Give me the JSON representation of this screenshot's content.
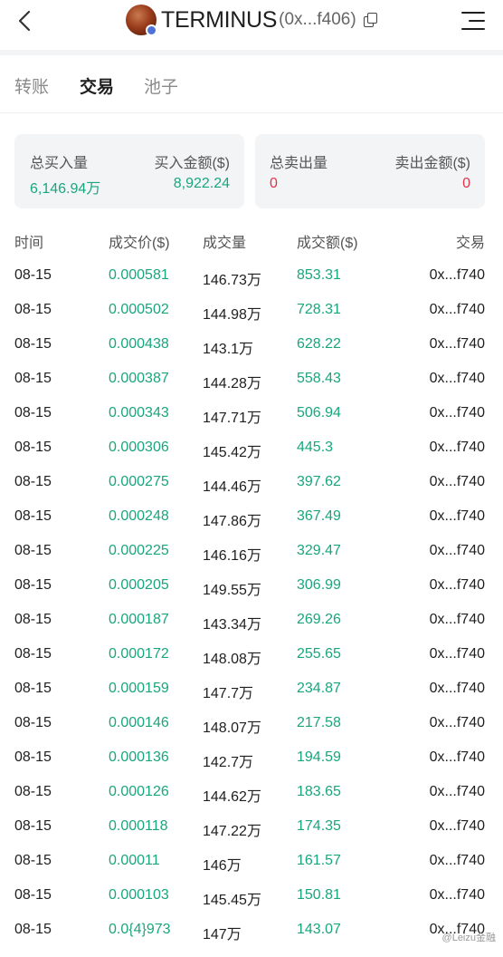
{
  "header": {
    "token_name": "TERMINUS",
    "token_address": "(0x...f406)"
  },
  "icons": {
    "back": "chevron-left-icon",
    "copy": "copy-icon",
    "menu": "menu-icon",
    "avatar": "token-avatar"
  },
  "tabs": [
    {
      "label": "转账"
    },
    {
      "label": "交易"
    },
    {
      "label": "池子"
    }
  ],
  "active_tab": "交易",
  "summary": {
    "buy": {
      "total_label": "总买入量",
      "total_value": "6,146.94万",
      "amount_label": "买入金额($)",
      "amount_value": "8,922.24"
    },
    "sell": {
      "total_label": "总卖出量",
      "total_value": "0",
      "amount_label": "卖出金额($)",
      "amount_value": "0"
    }
  },
  "table": {
    "headers": {
      "time": "时间",
      "price": "成交价($)",
      "volume": "成交量",
      "amount": "成交额($)",
      "tx": "交易"
    },
    "rows": [
      {
        "time": "08-15",
        "price": "0.000581",
        "volume": "146.73万",
        "amount": "853.31",
        "tx": "0x...f740"
      },
      {
        "time": "08-15",
        "price": "0.000502",
        "volume": "144.98万",
        "amount": "728.31",
        "tx": "0x...f740"
      },
      {
        "time": "08-15",
        "price": "0.000438",
        "volume": "143.1万",
        "amount": "628.22",
        "tx": "0x...f740"
      },
      {
        "time": "08-15",
        "price": "0.000387",
        "volume": "144.28万",
        "amount": "558.43",
        "tx": "0x...f740"
      },
      {
        "time": "08-15",
        "price": "0.000343",
        "volume": "147.71万",
        "amount": "506.94",
        "tx": "0x...f740"
      },
      {
        "time": "08-15",
        "price": "0.000306",
        "volume": "145.42万",
        "amount": "445.3",
        "tx": "0x...f740"
      },
      {
        "time": "08-15",
        "price": "0.000275",
        "volume": "144.46万",
        "amount": "397.62",
        "tx": "0x...f740"
      },
      {
        "time": "08-15",
        "price": "0.000248",
        "volume": "147.86万",
        "amount": "367.49",
        "tx": "0x...f740"
      },
      {
        "time": "08-15",
        "price": "0.000225",
        "volume": "146.16万",
        "amount": "329.47",
        "tx": "0x...f740"
      },
      {
        "time": "08-15",
        "price": "0.000205",
        "volume": "149.55万",
        "amount": "306.99",
        "tx": "0x...f740"
      },
      {
        "time": "08-15",
        "price": "0.000187",
        "volume": "143.34万",
        "amount": "269.26",
        "tx": "0x...f740"
      },
      {
        "time": "08-15",
        "price": "0.000172",
        "volume": "148.08万",
        "amount": "255.65",
        "tx": "0x...f740"
      },
      {
        "time": "08-15",
        "price": "0.000159",
        "volume": "147.7万",
        "amount": "234.87",
        "tx": "0x...f740"
      },
      {
        "time": "08-15",
        "price": "0.000146",
        "volume": "148.07万",
        "amount": "217.58",
        "tx": "0x...f740"
      },
      {
        "time": "08-15",
        "price": "0.000136",
        "volume": "142.7万",
        "amount": "194.59",
        "tx": "0x...f740"
      },
      {
        "time": "08-15",
        "price": "0.000126",
        "volume": "144.62万",
        "amount": "183.65",
        "tx": "0x...f740"
      },
      {
        "time": "08-15",
        "price": "0.000118",
        "volume": "147.22万",
        "amount": "174.35",
        "tx": "0x...f740"
      },
      {
        "time": "08-15",
        "price": "0.00011",
        "volume": "146万",
        "amount": "161.57",
        "tx": "0x...f740"
      },
      {
        "time": "08-15",
        "price": "0.000103",
        "volume": "145.45万",
        "amount": "150.81",
        "tx": "0x...f740"
      },
      {
        "time": "08-15",
        "price": "0.0{4}973",
        "volume": "147万",
        "amount": "143.07",
        "tx": "0x...f740"
      }
    ]
  },
  "watermark": "@Leizu金融",
  "colors": {
    "positive": "#19a67d",
    "negative": "#e0344a",
    "card_bg": "#f3f4f6"
  }
}
